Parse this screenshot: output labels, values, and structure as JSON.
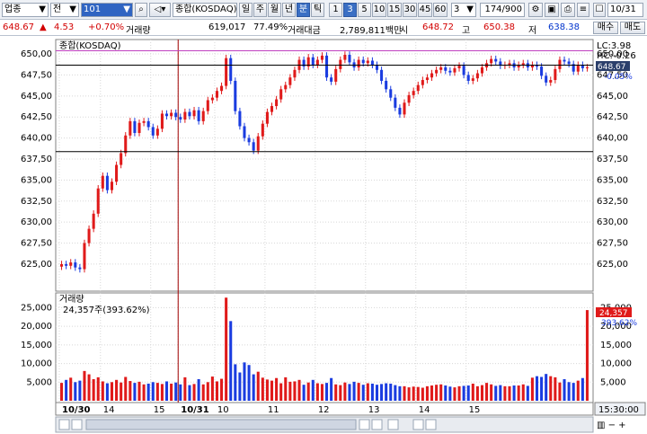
{
  "toolbar": {
    "market": "업종",
    "market_type": "전",
    "code": "101",
    "index_name": "종합(KOSDAQ)",
    "periods": [
      "일",
      "주",
      "월",
      "년",
      "분",
      "틱"
    ],
    "active_period": "분",
    "minutes": [
      "1",
      "3",
      "5",
      "10",
      "15",
      "30",
      "45",
      "60"
    ],
    "active_minute": "3",
    "unit_value": "3",
    "count": "174/900",
    "date": "10/31"
  },
  "quote": {
    "price": "648.67",
    "change": "4.53",
    "change_pct": "+0.70%",
    "volume_label": "거래량",
    "volume": "619,017",
    "volume_ratio": "77.49%",
    "amount_label": "거래대금",
    "amount": "2,789,811백만",
    "open_label": "시",
    "open": "648.72",
    "high_label": "고",
    "high": "650.38",
    "low_label": "저",
    "low": "638.38",
    "buy_label": "매수",
    "sell_label": "매도"
  },
  "colors": {
    "up": "#e01a1a",
    "down": "#1a3ce0",
    "grid": "#d8d8d8",
    "limit_line": "#c040c0"
  },
  "chart_data": [
    {
      "type": "candlestick",
      "title": "종합(KOSDAQ)",
      "ylim": [
        622,
        651.5
      ],
      "y_ticks": [
        "650,00",
        "647,50",
        "645,00",
        "642,50",
        "640,00",
        "637,50",
        "635,00",
        "632,50",
        "630,00",
        "627,50",
        "625,00"
      ],
      "right_labels": {
        "lc": "LC:3.98",
        "hc": "HC:-0.26",
        "price": "648.67",
        "pct": "-0.05%"
      },
      "h_lines": [
        650.38,
        648.67,
        638.38
      ],
      "close": [
        625.0,
        624.8,
        625.2,
        624.6,
        624.4,
        627.5,
        629.2,
        631.0,
        634.0,
        635.5,
        633.8,
        634.8,
        636.8,
        638.2,
        640.3,
        642.0,
        640.6,
        641.8,
        642.0,
        641.3,
        640.3,
        641.1,
        642.9,
        642.6,
        643.0,
        642.5,
        642.2,
        643.1,
        642.6,
        643.3,
        642.0,
        643.2,
        644.5,
        644.8,
        645.6,
        646.2,
        649.5,
        646.8,
        643.2,
        641.4,
        640.0,
        639.5,
        638.5,
        640.2,
        641.7,
        643.1,
        643.8,
        644.6,
        645.8,
        646.3,
        647.2,
        648.1,
        649.3,
        648.5,
        649.6,
        648.7,
        649.3,
        649.8,
        647.2,
        646.7,
        648.2,
        649.3,
        649.9,
        649.0,
        648.4,
        649.3,
        648.9,
        649.2,
        648.7,
        648.1,
        646.8,
        645.8,
        644.8,
        643.6,
        642.8,
        644.2,
        645.1,
        645.6,
        646.3,
        646.9,
        647.2,
        647.7,
        648.1,
        648.4,
        648.0,
        647.8,
        648.3,
        648.6,
        647.5,
        646.8,
        647.1,
        647.7,
        648.4,
        648.9,
        649.4,
        649.1,
        648.6,
        648.7,
        648.9,
        648.4,
        648.7,
        648.9,
        648.4,
        648.7,
        648.5,
        647.4,
        646.6,
        646.9,
        648.2,
        649.3,
        649.1,
        648.8,
        647.9,
        648.7,
        648.3,
        648.4
      ],
      "volume": {
        "label": "거래량",
        "current": "24,357주(393.62%)",
        "current_value": "24,357",
        "current_pct": "393.62%",
        "ylim": [
          0,
          28000
        ],
        "y_ticks": [
          "25,000",
          "20,000",
          "15,000",
          "10,000",
          "5,000"
        ],
        "values": [
          4800,
          5600,
          6200,
          5000,
          5400,
          8000,
          7100,
          5800,
          6300,
          5200,
          4700,
          5000,
          5600,
          4900,
          6400,
          5300,
          4800,
          5100,
          4400,
          4600,
          5000,
          4800,
          4500,
          5200,
          4600,
          4900,
          4400,
          6300,
          4200,
          4500,
          5800,
          4400,
          5000,
          6500,
          5200,
          5900,
          27700,
          21400,
          9800,
          7600,
          10300,
          9600,
          7100,
          7800,
          6200,
          5700,
          5400,
          6100,
          4700,
          6300,
          5100,
          5200,
          5600,
          4300,
          4900,
          5600,
          4700,
          4500,
          4800,
          6100,
          4400,
          4200,
          4900,
          4500,
          5100,
          4800,
          4300,
          4700,
          4600,
          4300,
          4500,
          4700,
          4600,
          4200,
          3900,
          3900,
          3600,
          3800,
          3700,
          3500,
          3900,
          4100,
          4300,
          4400,
          4100,
          3800,
          3600,
          3900,
          4000,
          4100,
          4600,
          3900,
          4200,
          4800,
          4400,
          4000,
          4200,
          3900,
          3900,
          4100,
          4100,
          4400,
          4000,
          6200,
          6600,
          6400,
          7200,
          6600,
          6300,
          4900,
          5800,
          5000,
          4800,
          5400,
          6100,
          24357
        ]
      },
      "x_labels": [
        "10/30",
        "14",
        "15",
        "10/31",
        "10",
        "11",
        "12",
        "13",
        "14",
        "15"
      ],
      "x_label_positions": [
        0,
        9,
        20,
        26,
        34,
        45,
        56,
        67,
        78,
        89
      ],
      "time": "15:30:00"
    }
  ]
}
